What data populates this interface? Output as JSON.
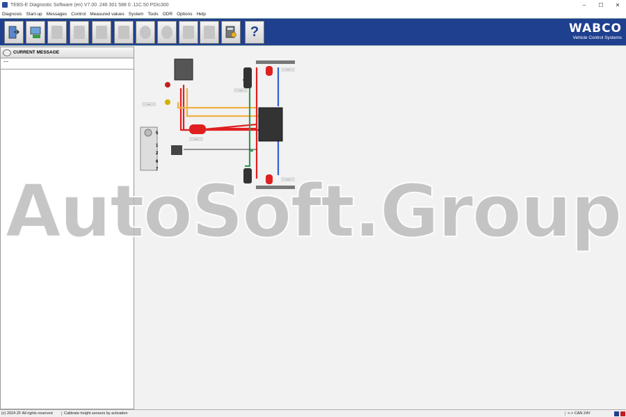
{
  "window": {
    "title": "TEBS-E Diagnostic Software (en) V7.00 .246 301 588 0 .11C.50 PDIc300",
    "controls": {
      "minimize": "–",
      "maximize": "☐",
      "close": "✕"
    }
  },
  "menu": [
    "Diagnosis",
    "Start-up",
    "Messages",
    "Control",
    "Measured values",
    "System",
    "Tools",
    "ODR",
    "Options",
    "Help"
  ],
  "toolbar": {
    "buttons": [
      {
        "name": "exit-icon",
        "enabled": true
      },
      {
        "name": "diagnosis-icon",
        "enabled": true
      },
      {
        "name": "print-icon",
        "enabled": false
      },
      {
        "name": "save-icon",
        "enabled": false
      },
      {
        "name": "load-icon",
        "enabled": false
      },
      {
        "name": "wrench-icon",
        "enabled": false
      },
      {
        "name": "brake-icon",
        "enabled": false
      },
      {
        "name": "gear-icon",
        "enabled": false
      },
      {
        "name": "parameter-up-icon",
        "enabled": false
      },
      {
        "name": "parameter-settings-icon",
        "enabled": false
      },
      {
        "name": "calculator-icon",
        "enabled": true
      }
    ],
    "help_label": "?"
  },
  "brand": {
    "logo": "WABCO",
    "subtitle": "Vehicle Control Systems"
  },
  "current_message": {
    "header": "CURRENT MESSAGE",
    "value": "---"
  },
  "diagram": {
    "connector_labels": [
      "5",
      "1",
      "2",
      "6",
      "7"
    ],
    "placeholder": "---"
  },
  "colors": {
    "toolbar_blue": "#1f3f8f",
    "red_line": "#e02020",
    "green_line": "#2e9a5a",
    "blue_line": "#2f5fd0",
    "orange_line": "#f0b040"
  },
  "status": {
    "copyright": "(c) 2024 ZF All rights reserved",
    "message": "Calibrate height sensors by activation",
    "connection": "<-> CAN 24V"
  },
  "watermark": "AutoSoft.Group"
}
